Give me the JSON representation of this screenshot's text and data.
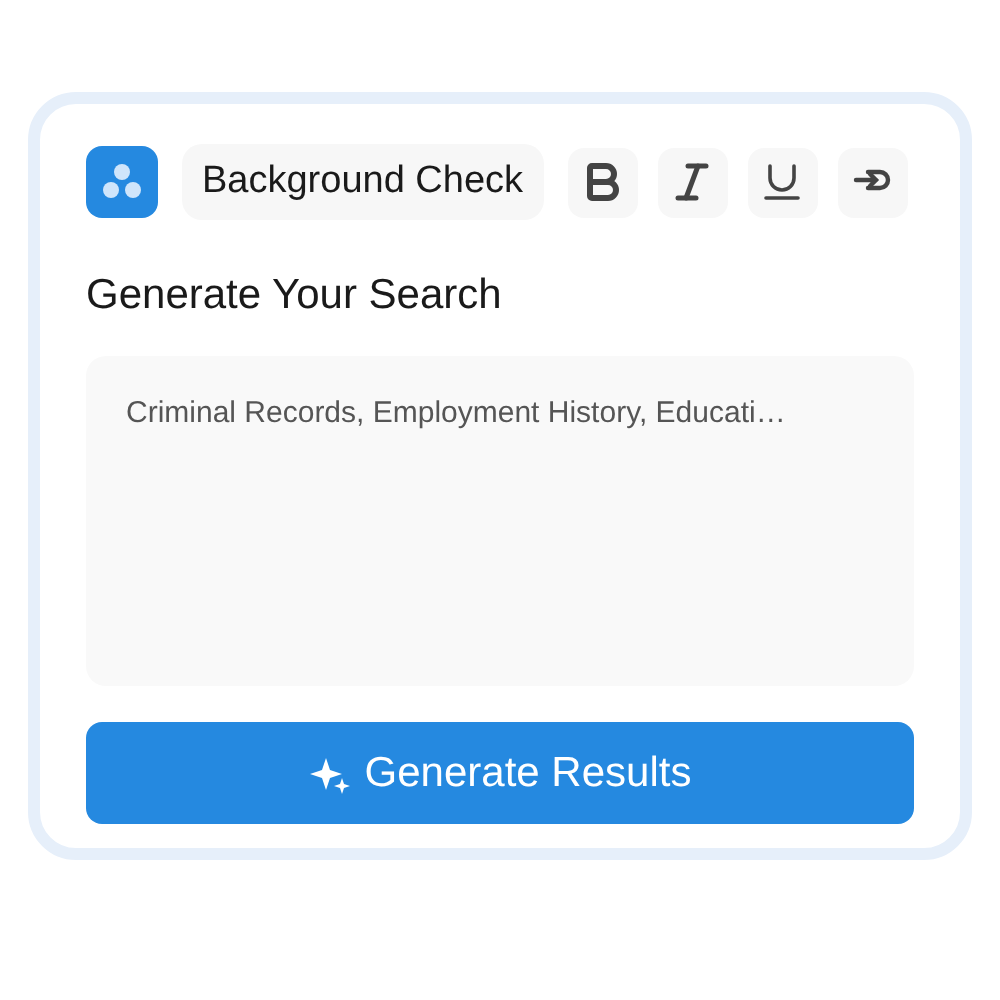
{
  "toolbar": {
    "title": "Background Check",
    "tools": [
      {
        "kind": "bold"
      },
      {
        "kind": "italic"
      },
      {
        "kind": "underline"
      },
      {
        "kind": "link"
      }
    ]
  },
  "heading": "Generate Your Search",
  "search": {
    "placeholder": "Criminal Records, Employment History, Educati…"
  },
  "generate_button": "Generate Results"
}
